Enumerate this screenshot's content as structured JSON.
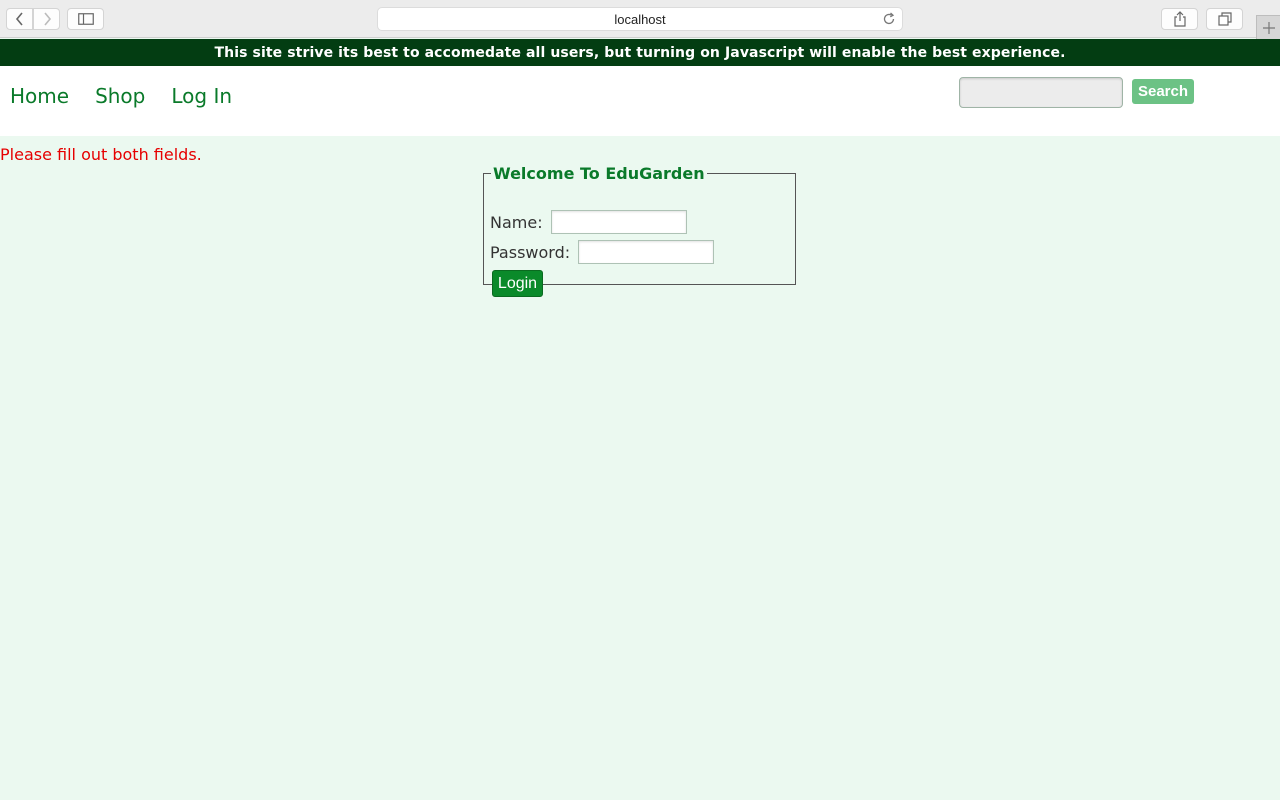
{
  "browser": {
    "url": "localhost"
  },
  "banner": {
    "text": "This site strive its best to accomedate all users, but turning on Javascript will enable the best experience."
  },
  "nav": {
    "items": [
      {
        "label": "Home"
      },
      {
        "label": "Shop"
      },
      {
        "label": "Log In"
      }
    ]
  },
  "search": {
    "placeholder": "",
    "value": "",
    "button_label": "Search"
  },
  "error": {
    "message": "Please fill out both fields."
  },
  "login": {
    "legend": "Welcome To EduGarden",
    "name_label": "Name:",
    "password_label": "Password:",
    "name_value": "",
    "password_value": "",
    "button_label": "Login"
  },
  "colors": {
    "banner_bg": "#033d12",
    "brand_green": "#0a7a2a",
    "page_bg": "#ebf9f0",
    "error_red": "#e60000",
    "search_button": "#6cc285"
  }
}
